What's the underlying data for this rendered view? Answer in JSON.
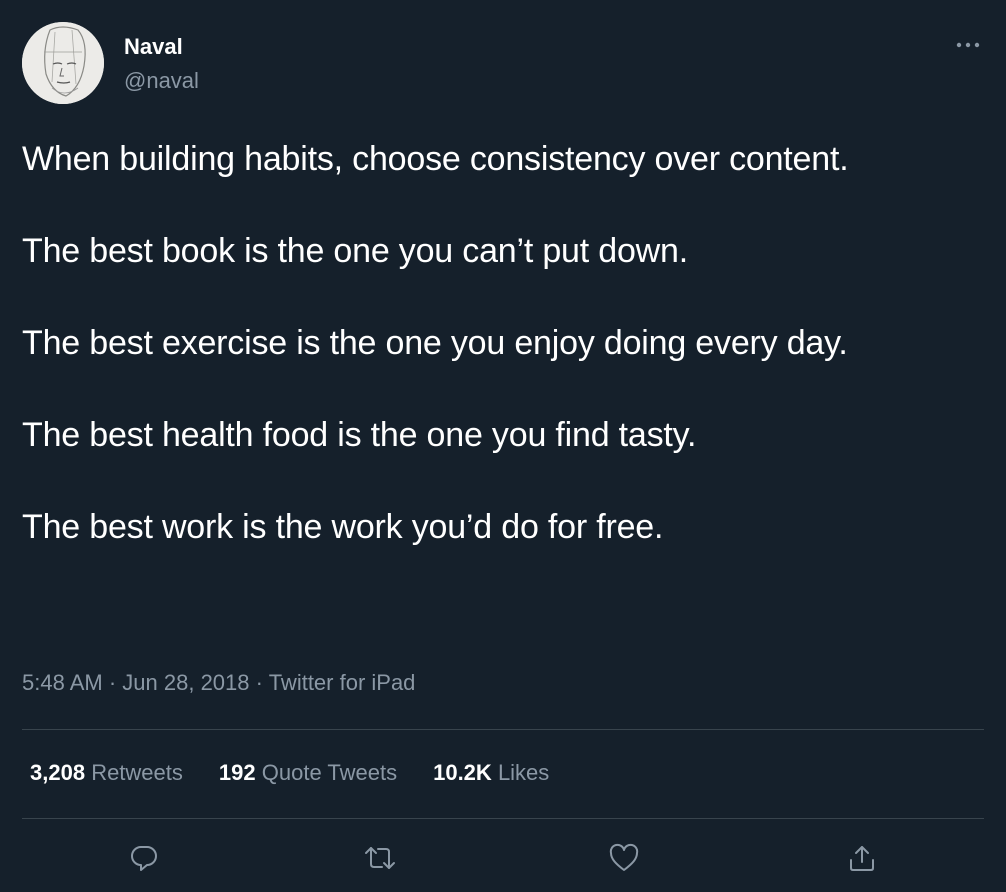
{
  "author": {
    "name": "Naval",
    "handle": "@naval"
  },
  "tweet": {
    "paragraphs": [
      "When building habits, choose consistency over content.",
      "The best book is the one you can’t put down.",
      "The best exercise is the one you enjoy doing every day.",
      "The best health food is the one you find tasty.",
      "The best work is the work you’d do for free."
    ],
    "time": "5:48 AM",
    "date": "Jun 28, 2018",
    "source": "Twitter for iPad",
    "separator": "·"
  },
  "stats": {
    "retweets": {
      "count": "3,208",
      "label": "Retweets"
    },
    "quotes": {
      "count": "192",
      "label": "Quote Tweets"
    },
    "likes": {
      "count": "10.2K",
      "label": "Likes"
    }
  },
  "icons": {
    "more": "more-icon",
    "reply": "reply-icon",
    "retweet": "retweet-icon",
    "like": "heart-icon",
    "share": "share-icon"
  },
  "colors": {
    "background": "#15202b",
    "text": "#ffffff",
    "secondary": "#8b98a5",
    "divider": "#38444d"
  }
}
